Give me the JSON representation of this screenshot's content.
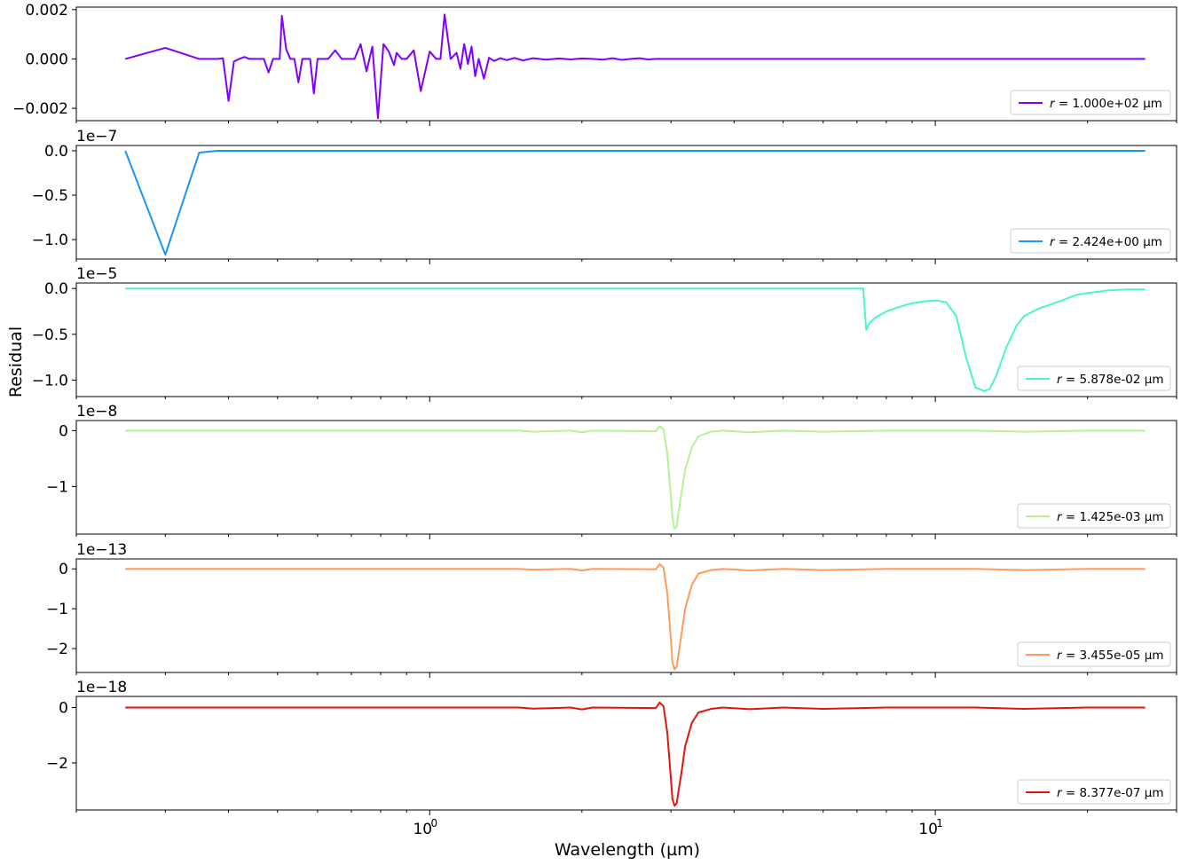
{
  "chart_data": {
    "type": "line",
    "xscale": "log",
    "xlim": [
      0.2,
      30
    ],
    "xlabel": "Wavelength (µm)",
    "ylabel": "Residual",
    "xticks": [
      {
        "value": 1,
        "label": "10",
        "exp": "0"
      },
      {
        "value": 10,
        "label": "10",
        "exp": "1"
      }
    ],
    "panels": [
      {
        "name": "r = 1.000e+02 µm",
        "legend_r": "r",
        "legend_rest": " = 1.000e+02 µm",
        "color": "#7f00ff",
        "offset": "",
        "ylim": [
          -0.0025,
          0.0021
        ],
        "yticks": [
          {
            "value": 0.002,
            "label": "0.002"
          },
          {
            "value": 0.0,
            "label": "0.000"
          },
          {
            "value": -0.002,
            "label": "−0.002"
          }
        ],
        "x": [
          0.25,
          0.3,
          0.35,
          0.38,
          0.39,
          0.4,
          0.41,
          0.42,
          0.43,
          0.44,
          0.45,
          0.47,
          0.48,
          0.49,
          0.5,
          0.505,
          0.51,
          0.52,
          0.53,
          0.54,
          0.55,
          0.56,
          0.57,
          0.58,
          0.59,
          0.6,
          0.61,
          0.63,
          0.65,
          0.67,
          0.69,
          0.71,
          0.73,
          0.75,
          0.77,
          0.79,
          0.81,
          0.83,
          0.85,
          0.86,
          0.88,
          0.9,
          0.93,
          0.96,
          1.0,
          1.03,
          1.05,
          1.07,
          1.1,
          1.13,
          1.15,
          1.17,
          1.19,
          1.21,
          1.23,
          1.25,
          1.28,
          1.31,
          1.34,
          1.38,
          1.42,
          1.47,
          1.53,
          1.6,
          1.7,
          1.8,
          1.9,
          2.0,
          2.1,
          2.2,
          2.3,
          2.4,
          2.5,
          2.6,
          2.7,
          2.8,
          3.0,
          4.0,
          6.0,
          10.0,
          15.0,
          20.0,
          26.0
        ],
        "y": [
          0.0,
          0.00045,
          0.0,
          0.0,
          3e-05,
          -0.0017,
          -0.0001,
          0.0,
          8e-05,
          0.0,
          0.0,
          0.0,
          -0.00055,
          0.0,
          0.0,
          0.0,
          0.00175,
          0.0004,
          0.0,
          0.0,
          -0.00095,
          0.0,
          0.0,
          0.0,
          -0.0014,
          0.0,
          0.0,
          0.0,
          0.00035,
          0.0,
          0.0,
          0.0,
          0.0006,
          -0.0005,
          0.0005,
          -0.0024,
          0.0006,
          0.0003,
          -0.00025,
          0.00025,
          0.0,
          0.0,
          0.00035,
          -0.0013,
          0.0003,
          0.0,
          0.0,
          0.0018,
          0.0,
          0.00025,
          -0.0004,
          0.0006,
          -0.0002,
          0.0005,
          -0.0007,
          0.0,
          -0.0008,
          5e-05,
          -8e-05,
          3e-05,
          -5e-05,
          4e-05,
          -6e-05,
          3e-05,
          -3e-05,
          2e-05,
          -2e-05,
          2e-05,
          0.0,
          -3e-05,
          3e-05,
          -4e-05,
          0.0,
          3e-05,
          -2e-05,
          0.0,
          0.0,
          0.0,
          0.0,
          0.0,
          0.0,
          0.0,
          0.0
        ]
      },
      {
        "name": "r = 2.424e+00 µm",
        "legend_r": "r",
        "legend_rest": " = 2.424e+00 µm",
        "color": "#1996f3",
        "offset": "1e−7",
        "ylim": [
          -1.22,
          0.06
        ],
        "yticks": [
          {
            "value": 0.0,
            "label": "0.0"
          },
          {
            "value": -0.5,
            "label": "−0.5"
          },
          {
            "value": -1.0,
            "label": "−1.0"
          }
        ],
        "x": [
          0.25,
          0.3,
          0.35,
          0.38,
          0.5,
          1.0,
          2.0,
          5.0,
          10.0,
          26.0
        ],
        "y": [
          0.0,
          -1.17,
          -0.02,
          0.0,
          0.0,
          0.0,
          0.0,
          0.0,
          0.0,
          0.0
        ]
      },
      {
        "name": "r = 5.878e-02 µm",
        "legend_r": "r",
        "legend_rest": " = 5.878e-02 µm",
        "color": "#4df3ce",
        "offset": "1e−5",
        "ylim": [
          -1.18,
          0.06
        ],
        "yticks": [
          {
            "value": 0.0,
            "label": "0.0"
          },
          {
            "value": -0.5,
            "label": "−0.5"
          },
          {
            "value": -1.0,
            "label": "−1.0"
          }
        ],
        "x": [
          0.25,
          1.0,
          3.0,
          7.2,
          7.3,
          7.4,
          7.6,
          8.0,
          8.5,
          9.0,
          9.5,
          10.0,
          10.5,
          11.0,
          11.5,
          12.0,
          12.5,
          12.8,
          13.2,
          13.8,
          14.5,
          15.0,
          16.0,
          17.0,
          18.0,
          19.0,
          20.0,
          22.0,
          24.0,
          26.0
        ],
        "y": [
          0.0,
          0.0,
          0.0,
          0.0,
          -0.45,
          -0.38,
          -0.32,
          -0.25,
          -0.2,
          -0.16,
          -0.14,
          -0.13,
          -0.15,
          -0.3,
          -0.75,
          -1.08,
          -1.12,
          -1.1,
          -0.95,
          -0.65,
          -0.4,
          -0.3,
          -0.22,
          -0.17,
          -0.12,
          -0.07,
          -0.05,
          -0.02,
          -0.01,
          -0.01
        ]
      },
      {
        "name": "r = 1.425e-03 µm",
        "legend_r": "r",
        "legend_rest": " = 1.425e-03 µm",
        "color": "#b2f396",
        "offset": "1e−8",
        "ylim": [
          -1.85,
          0.18
        ],
        "yticks": [
          {
            "value": 0.0,
            "label": "0"
          },
          {
            "value": -1.0,
            "label": "−1"
          }
        ],
        "x": [
          0.25,
          1.0,
          1.5,
          1.6,
          1.9,
          2.0,
          2.1,
          2.8,
          2.85,
          2.9,
          2.95,
          3.0,
          3.02,
          3.05,
          3.08,
          3.1,
          3.15,
          3.2,
          3.3,
          3.4,
          3.6,
          3.8,
          4.3,
          5.0,
          6.0,
          8.0,
          10.0,
          12.0,
          15.0,
          20.0,
          26.0
        ],
        "y": [
          0.0,
          0.0,
          0.0,
          -0.02,
          0.0,
          -0.03,
          0.0,
          -0.01,
          0.08,
          0.02,
          -0.4,
          -1.2,
          -1.55,
          -1.75,
          -1.72,
          -1.5,
          -1.1,
          -0.7,
          -0.3,
          -0.1,
          -0.02,
          0.0,
          -0.03,
          0.0,
          -0.02,
          0.0,
          0.0,
          0.0,
          -0.02,
          0.0,
          0.0
        ]
      },
      {
        "name": "r = 3.455e-05 µm",
        "legend_r": "r",
        "legend_rest": " = 3.455e-05 µm",
        "color": "#ff9a59",
        "offset": "1e−13",
        "ylim": [
          -2.6,
          0.25
        ],
        "yticks": [
          {
            "value": 0.0,
            "label": "0"
          },
          {
            "value": -1.0,
            "label": "−1"
          },
          {
            "value": -2.0,
            "label": "−2"
          }
        ],
        "x": [
          0.25,
          1.0,
          1.5,
          1.6,
          1.9,
          2.0,
          2.1,
          2.8,
          2.85,
          2.9,
          2.95,
          3.0,
          3.02,
          3.05,
          3.08,
          3.1,
          3.15,
          3.2,
          3.3,
          3.4,
          3.6,
          3.8,
          4.3,
          5.0,
          6.0,
          8.0,
          10.0,
          12.0,
          15.0,
          20.0,
          26.0
        ],
        "y": [
          0.0,
          0.0,
          0.0,
          -0.02,
          0.0,
          -0.04,
          0.0,
          -0.01,
          0.12,
          0.03,
          -0.6,
          -1.8,
          -2.35,
          -2.52,
          -2.45,
          -2.2,
          -1.6,
          -1.0,
          -0.4,
          -0.12,
          -0.03,
          0.0,
          -0.04,
          0.0,
          -0.03,
          0.0,
          0.0,
          0.0,
          -0.03,
          0.0,
          0.0
        ]
      },
      {
        "name": "r = 8.377e-07 µm",
        "legend_r": "r",
        "legend_rest": " = 8.377e-07 µm",
        "color": "#e2150b",
        "offset": "1e−18",
        "ylim": [
          -3.7,
          0.4
        ],
        "yticks": [
          {
            "value": 0.0,
            "label": "0"
          },
          {
            "value": -2.0,
            "label": "−2"
          }
        ],
        "x": [
          0.25,
          1.0,
          1.5,
          1.6,
          1.9,
          2.0,
          2.1,
          2.8,
          2.85,
          2.9,
          2.95,
          3.0,
          3.02,
          3.05,
          3.08,
          3.1,
          3.15,
          3.2,
          3.3,
          3.4,
          3.6,
          3.8,
          4.3,
          5.0,
          6.0,
          8.0,
          10.0,
          12.0,
          15.0,
          20.0,
          26.0
        ],
        "y": [
          0.0,
          0.0,
          0.0,
          -0.04,
          0.0,
          -0.07,
          0.0,
          -0.02,
          0.18,
          0.05,
          -0.9,
          -2.6,
          -3.3,
          -3.55,
          -3.45,
          -3.1,
          -2.3,
          -1.4,
          -0.55,
          -0.18,
          -0.05,
          0.0,
          -0.06,
          0.0,
          -0.05,
          0.0,
          0.0,
          0.0,
          -0.05,
          0.0,
          0.0
        ]
      }
    ]
  }
}
